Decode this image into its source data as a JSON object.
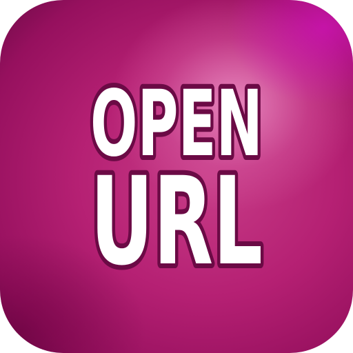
{
  "icon": {
    "line1": "OPEN",
    "line2": "URL",
    "colors": {
      "text_fill": "#ffffff",
      "text_outline": "#6b0a45",
      "background_primary": "#b52073",
      "background_highlight": "#ee96c8",
      "background_dark": "#6d0a47"
    }
  }
}
